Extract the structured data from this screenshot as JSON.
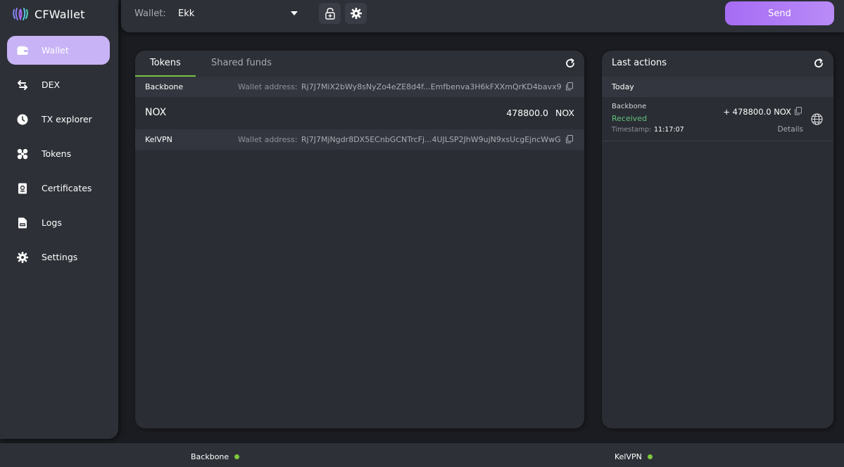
{
  "app": {
    "name": "CFWallet"
  },
  "sidebar": {
    "items": [
      {
        "label": "Wallet",
        "icon": "wallet-icon",
        "active": true
      },
      {
        "label": "DEX",
        "icon": "exchange-arrows-icon",
        "active": false
      },
      {
        "label": "TX explorer",
        "icon": "clock-icon",
        "active": false
      },
      {
        "label": "Tokens",
        "icon": "tokens-icon",
        "active": false
      },
      {
        "label": "Certificates",
        "icon": "certificate-icon",
        "active": false
      },
      {
        "label": "Logs",
        "icon": "log-file-icon",
        "active": false
      },
      {
        "label": "Settings",
        "icon": "gear-icon",
        "active": false
      }
    ]
  },
  "topbar": {
    "wallet_label": "Wallet:",
    "wallet_value": "Ekk",
    "send_label": "Send"
  },
  "tokens_panel": {
    "tabs": [
      {
        "label": "Tokens",
        "active": true
      },
      {
        "label": "Shared funds",
        "active": false
      }
    ],
    "networks": [
      {
        "name": "Backbone",
        "address_label": "Wallet address:",
        "address": "Rj7J7MiX2bWy8sNyZo4eZE8d4f...Emfbenva3H6kFXXmQrKD4bavx9",
        "tokens": [
          {
            "name": "NOX",
            "amount": "478800.0",
            "ticker": "NOX"
          }
        ]
      },
      {
        "name": "KelVPN",
        "address_label": "Wallet address:",
        "address": "Rj7J7MjNgdr8DX5ECnbGCNTrcFj...4UJLSP2JhW9ujN9xsUcgEjncWwG",
        "tokens": []
      }
    ]
  },
  "actions_panel": {
    "title": "Last actions",
    "day": "Today",
    "items": [
      {
        "network": "Backbone",
        "status": "Received",
        "timestamp_label": "Timestamp:",
        "timestamp": "11:17:07",
        "amount": "+ 478800.0 NOX",
        "details_label": "Details"
      }
    ]
  },
  "statusbar": {
    "networks": [
      {
        "name": "Backbone",
        "status_color": "#7dc83e"
      },
      {
        "name": "KelVPN",
        "status_color": "#7dc83e"
      }
    ]
  },
  "colors": {
    "accent": "#b98bf7",
    "active_nav": "#c7b3f5",
    "tab_underline": "#79c244",
    "received": "#64c27c"
  }
}
